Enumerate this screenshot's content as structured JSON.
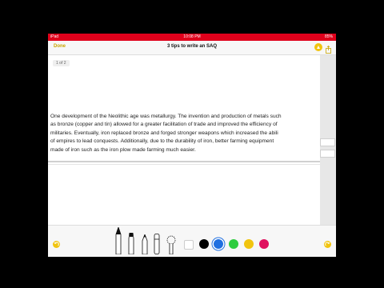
{
  "status_bar": {
    "carrier": "iPad",
    "time": "10:08 PM",
    "battery": "85%"
  },
  "nav": {
    "done_label": "Done",
    "title": "3 tips to write an SAQ"
  },
  "page_badge": "1 of 2",
  "document": {
    "lines": [
      "One development of the Neolithic age was metallurgy. The invention and production of metals such",
      "as bronze (copper and tin) allowed for a greater facilitation of trade and improved the efficiency of",
      "militaries. Eventually, iron replaced bronze and forged stronger weapons which increased the abili",
      "of empires to lead conquests. Additionally, due to the durability of iron, better farming equipment",
      "made of iron such as the iron plow made farming much easier."
    ]
  },
  "colors": {
    "status_bar": "#e0001b",
    "accent": "#f1c40f",
    "palette": [
      "#ffffff",
      "#000000",
      "#1f6fe0",
      "#2ecc40",
      "#f1c40f",
      "#e0115f"
    ],
    "selected_color": "#1f6fe0"
  },
  "icons": {
    "markup": "pencil-tip-icon",
    "share": "share-icon",
    "undo": "undo-icon",
    "redo": "redo-icon",
    "tools": [
      "pen-icon",
      "marker-icon",
      "pencil-icon",
      "eraser-icon",
      "lasso-icon"
    ]
  }
}
